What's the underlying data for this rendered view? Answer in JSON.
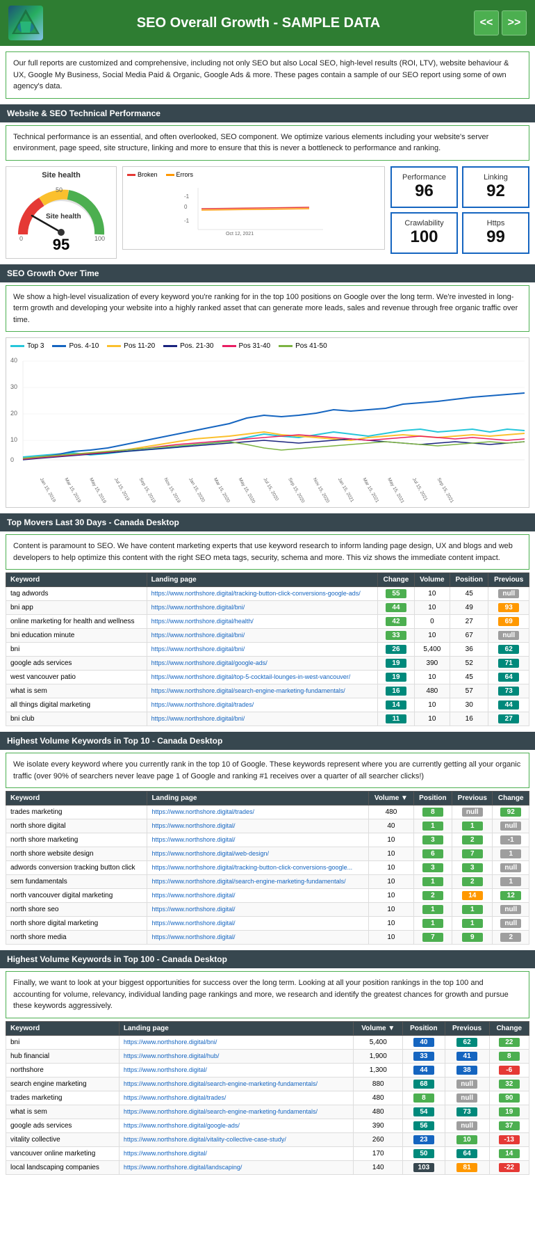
{
  "header": {
    "title": "SEO Overall Growth - SAMPLE DATA",
    "prev_label": "<<",
    "next_label": ">>"
  },
  "intro": {
    "text": "Our full reports are customized and comprehensive, including not only SEO but also Local SEO, high-level results (ROI, LTV), website behaviour & UX, Google My Business, Social Media Paid & Organic, Google Ads & more. These pages contain a sample of our SEO report using some of own agency's data."
  },
  "section1": {
    "header": "Website & SEO Technical Performance",
    "desc": "Technical performance is an essential, and often overlooked, SEO component. We optimize various elements including your website's server environment, page speed, site structure, linking and more to ensure that this is never a bottleneck to performance and ranking.",
    "gauge": {
      "title": "Site health",
      "value": "95"
    },
    "kpis": [
      {
        "label": "Performance",
        "value": "96"
      },
      {
        "label": "Linking",
        "value": "92"
      },
      {
        "label": "Crawlability",
        "value": "100"
      },
      {
        "label": "Https",
        "value": "99"
      }
    ]
  },
  "section2": {
    "header": "SEO Growth Over Time",
    "desc": "We show a high-level visualization of every keyword you're ranking for in the top 100 positions on Google over the long term. We're invested in long-term growth and developing your website into a highly ranked asset that can generate more leads, sales and revenue through free organic traffic over time.",
    "legend": [
      {
        "label": "Top 3",
        "color": "#26c6da"
      },
      {
        "label": "Pos. 4-10",
        "color": "#1565c0"
      },
      {
        "label": "Pos 11-20",
        "color": "#fbc02d"
      },
      {
        "label": "Pos. 21-30",
        "color": "#1a237e"
      },
      {
        "label": "Pos 31-40",
        "color": "#e91e63"
      },
      {
        "label": "Pos 41-50",
        "color": "#7cb342"
      }
    ]
  },
  "section3": {
    "header": "Top Movers Last 30 Days - Canada Desktop",
    "desc": "Content is paramount to SEO. We have content marketing experts that use keyword research to inform landing page design, UX and blogs and web developers to help optimize this content with the right SEO meta tags, security, schema and more. This viz shows the immediate content impact.",
    "table": {
      "columns": [
        "Keyword",
        "Landing page",
        "Change",
        "Volume",
        "Position",
        "Previous"
      ],
      "rows": [
        {
          "keyword": "tag adwords",
          "url": "https://www.northshore.digital/tracking-button-click-conversions-google-ads/",
          "change": "55",
          "change_color": "badge-green",
          "volume": "10",
          "position": "45",
          "previous": "null",
          "prev_color": "badge-gray"
        },
        {
          "keyword": "bni app",
          "url": "https://www.northshore.digital/bni/",
          "change": "44",
          "change_color": "badge-green",
          "volume": "10",
          "position": "49",
          "previous": "93",
          "prev_color": "badge-orange"
        },
        {
          "keyword": "online marketing for health and wellness",
          "url": "https://www.northshore.digital/health/",
          "change": "42",
          "change_color": "badge-green",
          "volume": "0",
          "position": "27",
          "previous": "69",
          "prev_color": "badge-orange"
        },
        {
          "keyword": "bni education minute",
          "url": "https://www.northshore.digital/bni/",
          "change": "33",
          "change_color": "badge-green",
          "volume": "10",
          "position": "67",
          "previous": "null",
          "prev_color": "badge-gray"
        },
        {
          "keyword": "bni",
          "url": "https://www.northshore.digital/bni/",
          "change": "26",
          "change_color": "badge-teal",
          "volume": "5,400",
          "position": "36",
          "previous": "62",
          "prev_color": "badge-teal"
        },
        {
          "keyword": "google ads services",
          "url": "https://www.northshore.digital/google-ads/",
          "change": "19",
          "change_color": "badge-teal",
          "volume": "390",
          "position": "52",
          "previous": "71",
          "prev_color": "badge-teal"
        },
        {
          "keyword": "west vancouver patio",
          "url": "https://www.northshore.digital/top-5-cocktail-lounges-in-west-vancouver/",
          "change": "19",
          "change_color": "badge-teal",
          "volume": "10",
          "position": "45",
          "previous": "64",
          "prev_color": "badge-teal"
        },
        {
          "keyword": "what is sem",
          "url": "https://www.northshore.digital/search-engine-marketing-fundamentals/",
          "change": "16",
          "change_color": "badge-teal",
          "volume": "480",
          "position": "57",
          "previous": "73",
          "prev_color": "badge-teal"
        },
        {
          "keyword": "all things digital marketing",
          "url": "https://www.northshore.digital/trades/",
          "change": "14",
          "change_color": "badge-teal",
          "volume": "10",
          "position": "30",
          "previous": "44",
          "prev_color": "badge-teal"
        },
        {
          "keyword": "bni club",
          "url": "https://www.northshore.digital/bni/",
          "change": "11",
          "change_color": "badge-teal",
          "volume": "10",
          "position": "16",
          "previous": "27",
          "prev_color": "badge-teal"
        }
      ]
    }
  },
  "section4": {
    "header": "Highest Volume Keywords in Top 10 - Canada Desktop",
    "desc": "We isolate every keyword where you currently rank in the top 10 of Google. These keywords represent where you are currently getting all your organic traffic (over 90% of searchers never leave page 1 of Google and ranking #1 receives over a quarter of all searcher clicks!)",
    "table": {
      "columns": [
        "Keyword",
        "Landing page",
        "Volume ▼",
        "Position",
        "Previous",
        "Change"
      ],
      "rows": [
        {
          "keyword": "trades marketing",
          "url": "https://www.northshore.digital/trades/",
          "volume": "480",
          "position": "8",
          "pos_color": "badge-green",
          "previous": "null",
          "prev_color": "badge-gray",
          "change": "92",
          "change_color": "badge-green"
        },
        {
          "keyword": "north shore digital",
          "url": "https://www.northshore.digital/",
          "volume": "40",
          "position": "1",
          "pos_color": "badge-green",
          "previous": "1",
          "prev_color": "badge-green",
          "change": "null",
          "change_color": "badge-gray"
        },
        {
          "keyword": "north shore marketing",
          "url": "https://www.northshore.digital/",
          "volume": "10",
          "position": "3",
          "pos_color": "badge-green",
          "previous": "2",
          "prev_color": "badge-green",
          "change": "-1",
          "change_color": "badge-gray"
        },
        {
          "keyword": "north shore website design",
          "url": "https://www.northshore.digital/web-design/",
          "volume": "10",
          "position": "6",
          "pos_color": "badge-green",
          "previous": "7",
          "prev_color": "badge-green",
          "change": "1",
          "change_color": "badge-gray"
        },
        {
          "keyword": "adwords conversion tracking button click",
          "url": "https://www.northshore.digital/tracking-button-click-conversions-google...",
          "volume": "10",
          "position": "3",
          "pos_color": "badge-green",
          "previous": "3",
          "prev_color": "badge-green",
          "change": "null",
          "change_color": "badge-gray"
        },
        {
          "keyword": "sem fundamentals",
          "url": "https://www.northshore.digital/search-engine-marketing-fundamentals/",
          "volume": "10",
          "position": "1",
          "pos_color": "badge-green",
          "previous": "2",
          "prev_color": "badge-green",
          "change": "1",
          "change_color": "badge-gray"
        },
        {
          "keyword": "north vancouver digital marketing",
          "url": "https://www.northshore.digital/",
          "volume": "10",
          "position": "2",
          "pos_color": "badge-green",
          "previous": "14",
          "prev_color": "badge-orange",
          "change": "12",
          "change_color": "badge-green"
        },
        {
          "keyword": "north shore seo",
          "url": "https://www.northshore.digital/",
          "volume": "10",
          "position": "1",
          "pos_color": "badge-green",
          "previous": "1",
          "prev_color": "badge-green",
          "change": "null",
          "change_color": "badge-gray"
        },
        {
          "keyword": "north shore digital marketing",
          "url": "https://www.northshore.digital/",
          "volume": "10",
          "position": "1",
          "pos_color": "badge-green",
          "previous": "1",
          "prev_color": "badge-green",
          "change": "null",
          "change_color": "badge-gray"
        },
        {
          "keyword": "north shore media",
          "url": "https://www.northshore.digital/",
          "volume": "10",
          "position": "7",
          "pos_color": "badge-green",
          "previous": "9",
          "prev_color": "badge-green",
          "change": "2",
          "change_color": "badge-gray"
        }
      ]
    }
  },
  "section5": {
    "header": "Highest Volume Keywords in Top 100 - Canada Desktop",
    "desc": "Finally, we want to look at your biggest opportunities for success over the long term. Looking at all your position rankings in the top 100 and accounting for volume, relevancy, individual landing page rankings and more, we research and identify the greatest chances for growth and pursue these keywords aggressively.",
    "table": {
      "columns": [
        "Keyword",
        "Landing page",
        "Volume ▼",
        "Position",
        "Previous",
        "Change"
      ],
      "rows": [
        {
          "keyword": "bni",
          "url": "https://www.northshore.digital/bni/",
          "volume": "5,400",
          "pos": "40",
          "pos_color": "badge-blue",
          "previous": "62",
          "prev_color": "badge-teal",
          "change": "22",
          "change_color": "badge-green"
        },
        {
          "keyword": "hub financial",
          "url": "https://www.northshore.digital/hub/",
          "volume": "1,900",
          "pos": "33",
          "pos_color": "badge-blue",
          "previous": "41",
          "prev_color": "badge-blue",
          "change": "8",
          "change_color": "badge-green"
        },
        {
          "keyword": "northshore",
          "url": "https://www.northshore.digital/",
          "volume": "1,300",
          "pos": "44",
          "pos_color": "badge-blue",
          "previous": "38",
          "prev_color": "badge-blue",
          "change": "-6",
          "change_color": "badge-red"
        },
        {
          "keyword": "search engine marketing",
          "url": "https://www.northshore.digital/search-engine-marketing-fundamentals/",
          "volume": "880",
          "pos": "68",
          "pos_color": "badge-teal",
          "previous": "null",
          "prev_color": "badge-gray",
          "change": "32",
          "change_color": "badge-green"
        },
        {
          "keyword": "trades marketing",
          "url": "https://www.northshore.digital/trades/",
          "volume": "480",
          "pos": "8",
          "pos_color": "badge-green",
          "previous": "null",
          "prev_color": "badge-gray",
          "change": "90",
          "change_color": "badge-green"
        },
        {
          "keyword": "what is sem",
          "url": "https://www.northshore.digital/search-engine-marketing-fundamentals/",
          "volume": "480",
          "pos": "54",
          "pos_color": "badge-teal",
          "previous": "73",
          "prev_color": "badge-teal",
          "change": "19",
          "change_color": "badge-green"
        },
        {
          "keyword": "google ads services",
          "url": "https://www.northshore.digital/google-ads/",
          "volume": "390",
          "pos": "56",
          "pos_color": "badge-teal",
          "previous": "null",
          "prev_color": "badge-gray",
          "change": "37",
          "change_color": "badge-green"
        },
        {
          "keyword": "vitality collective",
          "url": "https://www.northshore.digital/vitality-collective-case-study/",
          "volume": "260",
          "pos": "23",
          "pos_color": "badge-blue",
          "previous": "10",
          "prev_color": "badge-green",
          "change": "-13",
          "change_color": "badge-red"
        },
        {
          "keyword": "vancouver online marketing",
          "url": "https://www.northshore.digital/",
          "volume": "170",
          "pos": "50",
          "pos_color": "badge-teal",
          "previous": "64",
          "prev_color": "badge-teal",
          "change": "14",
          "change_color": "badge-green"
        },
        {
          "keyword": "local landscaping companies",
          "url": "https://www.northshore.digital/landscaping/",
          "volume": "140",
          "pos": "103",
          "pos_color": "badge-dark",
          "previous": "81",
          "prev_color": "badge-orange",
          "change": "-22",
          "change_color": "badge-red"
        }
      ]
    }
  }
}
